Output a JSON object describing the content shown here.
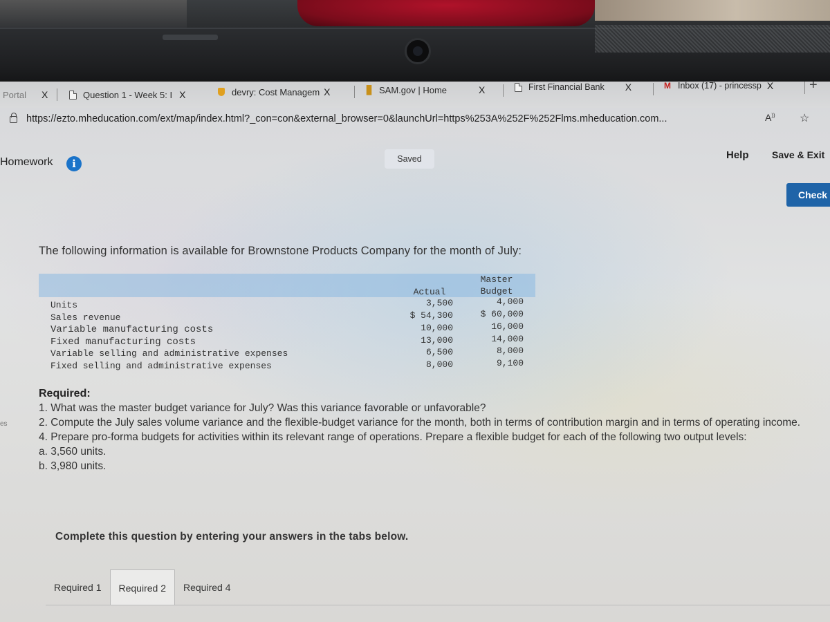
{
  "browser": {
    "tabs": [
      {
        "label": "Portal",
        "icon": "page-icon",
        "closable": true
      },
      {
        "label": "Question 1 - Week 5: I",
        "icon": "document-icon",
        "closable": true
      },
      {
        "label": "devry: Cost Managem",
        "icon": "devry-shield-icon",
        "closable": true
      },
      {
        "label": "SAM.gov | Home",
        "icon": "sam-gov-icon",
        "closable": true
      },
      {
        "label": "First Financial Bank",
        "icon": "document-icon",
        "closable": true
      },
      {
        "label": "Inbox (17) - princessp",
        "icon": "gmail-icon",
        "closable": true
      }
    ],
    "close_glyph": "X",
    "new_tab_glyph": "+",
    "url": "https://ezto.mheducation.com/ext/map/index.html?_con=con&external_browser=0&launchUrl=https%253A%252F%252Flms.mheducation.com...",
    "reader_glyph": "A̅",
    "favorite_glyph": "☆"
  },
  "app": {
    "title": "Homework",
    "info_glyph": "i",
    "save_status": "Saved",
    "help_label": "Help",
    "save_exit_label": "Save & Exit",
    "check_label": "Check",
    "left_edge_text": "es"
  },
  "question": {
    "intro": "The following information is available for Brownstone Products Company for the month of July:",
    "table": {
      "columns": [
        {
          "line1": "",
          "line2": "Actual"
        },
        {
          "line1": "Master",
          "line2": "Budget"
        }
      ],
      "rows": [
        {
          "label": "Units",
          "actual": "3,500",
          "budget": "4,000"
        },
        {
          "label": "Sales revenue",
          "actual": "$ 54,300",
          "budget": "$ 60,000"
        },
        {
          "label": "Variable manufacturing costs",
          "actual": "10,000",
          "budget": "16,000"
        },
        {
          "label": "Fixed manufacturing costs",
          "actual": "13,000",
          "budget": "14,000"
        },
        {
          "label": "Variable selling and administrative expenses",
          "actual": "6,500",
          "budget": "8,000"
        },
        {
          "label": "Fixed selling and administrative expenses",
          "actual": "8,000",
          "budget": "9,100"
        }
      ]
    },
    "required": {
      "heading": "Required:",
      "items": [
        "1. What was the master budget variance for July? Was this variance favorable or unfavorable?",
        "2. Compute the July sales volume variance and the flexible-budget variance for the month, both in terms of contribution margin and in terms of operating income.",
        "4. Prepare pro-forma budgets for activities within its relevant range of operations. Prepare a flexible budget for each of the following two output levels:",
        "a. 3,560 units.",
        "b. 3,980 units."
      ]
    },
    "instruction": "Complete this question by entering your answers in the tabs below.",
    "answer_tabs": [
      {
        "label": "Required 1",
        "active": false
      },
      {
        "label": "Required 2",
        "active": true
      },
      {
        "label": "Required 4",
        "active": false
      }
    ]
  },
  "colors": {
    "accent": "#1f64a8",
    "info": "#1a73c9",
    "table_header": "#8cb9e1"
  }
}
